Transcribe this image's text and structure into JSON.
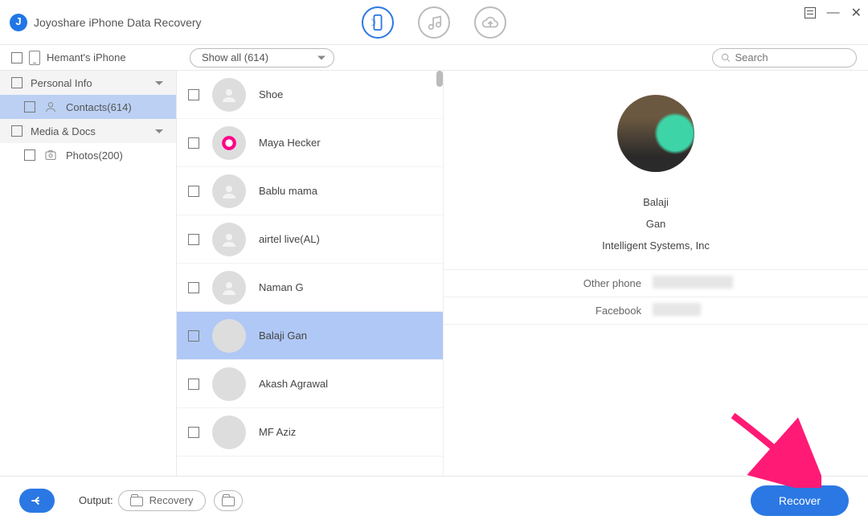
{
  "app": {
    "title": "Joyoshare iPhone Data Recovery"
  },
  "device": {
    "name": "Hemant's iPhone"
  },
  "filter": {
    "label": "Show all (614)"
  },
  "search": {
    "placeholder": "Search"
  },
  "sidebar": {
    "cat_personal": "Personal Info",
    "contacts": "Contacts(614)",
    "cat_media": "Media & Docs",
    "photos": "Photos(200)"
  },
  "contacts": [
    {
      "name": "Shoe",
      "avatar": "generic"
    },
    {
      "name": "Maya Hecker",
      "avatar": "maya"
    },
    {
      "name": "Bablu mama",
      "avatar": "generic"
    },
    {
      "name": "airtel live(AL)",
      "avatar": "generic"
    },
    {
      "name": "Naman G",
      "avatar": "generic"
    },
    {
      "name": "Balaji Gan",
      "avatar": "balaji",
      "selected": true
    },
    {
      "name": "Akash Agrawal",
      "avatar": "akash"
    },
    {
      "name": "MF Aziz",
      "avatar": "mfaziz"
    }
  ],
  "detail": {
    "first_name": "Balaji",
    "last_name": "Gan",
    "company": "Intelligent Systems, Inc",
    "fields": [
      {
        "key": "Other phone",
        "value": ""
      },
      {
        "key": "Facebook",
        "value": ""
      }
    ]
  },
  "bottom": {
    "output_label": "Output:",
    "output_path": "Recovery",
    "recover": "Recover"
  }
}
